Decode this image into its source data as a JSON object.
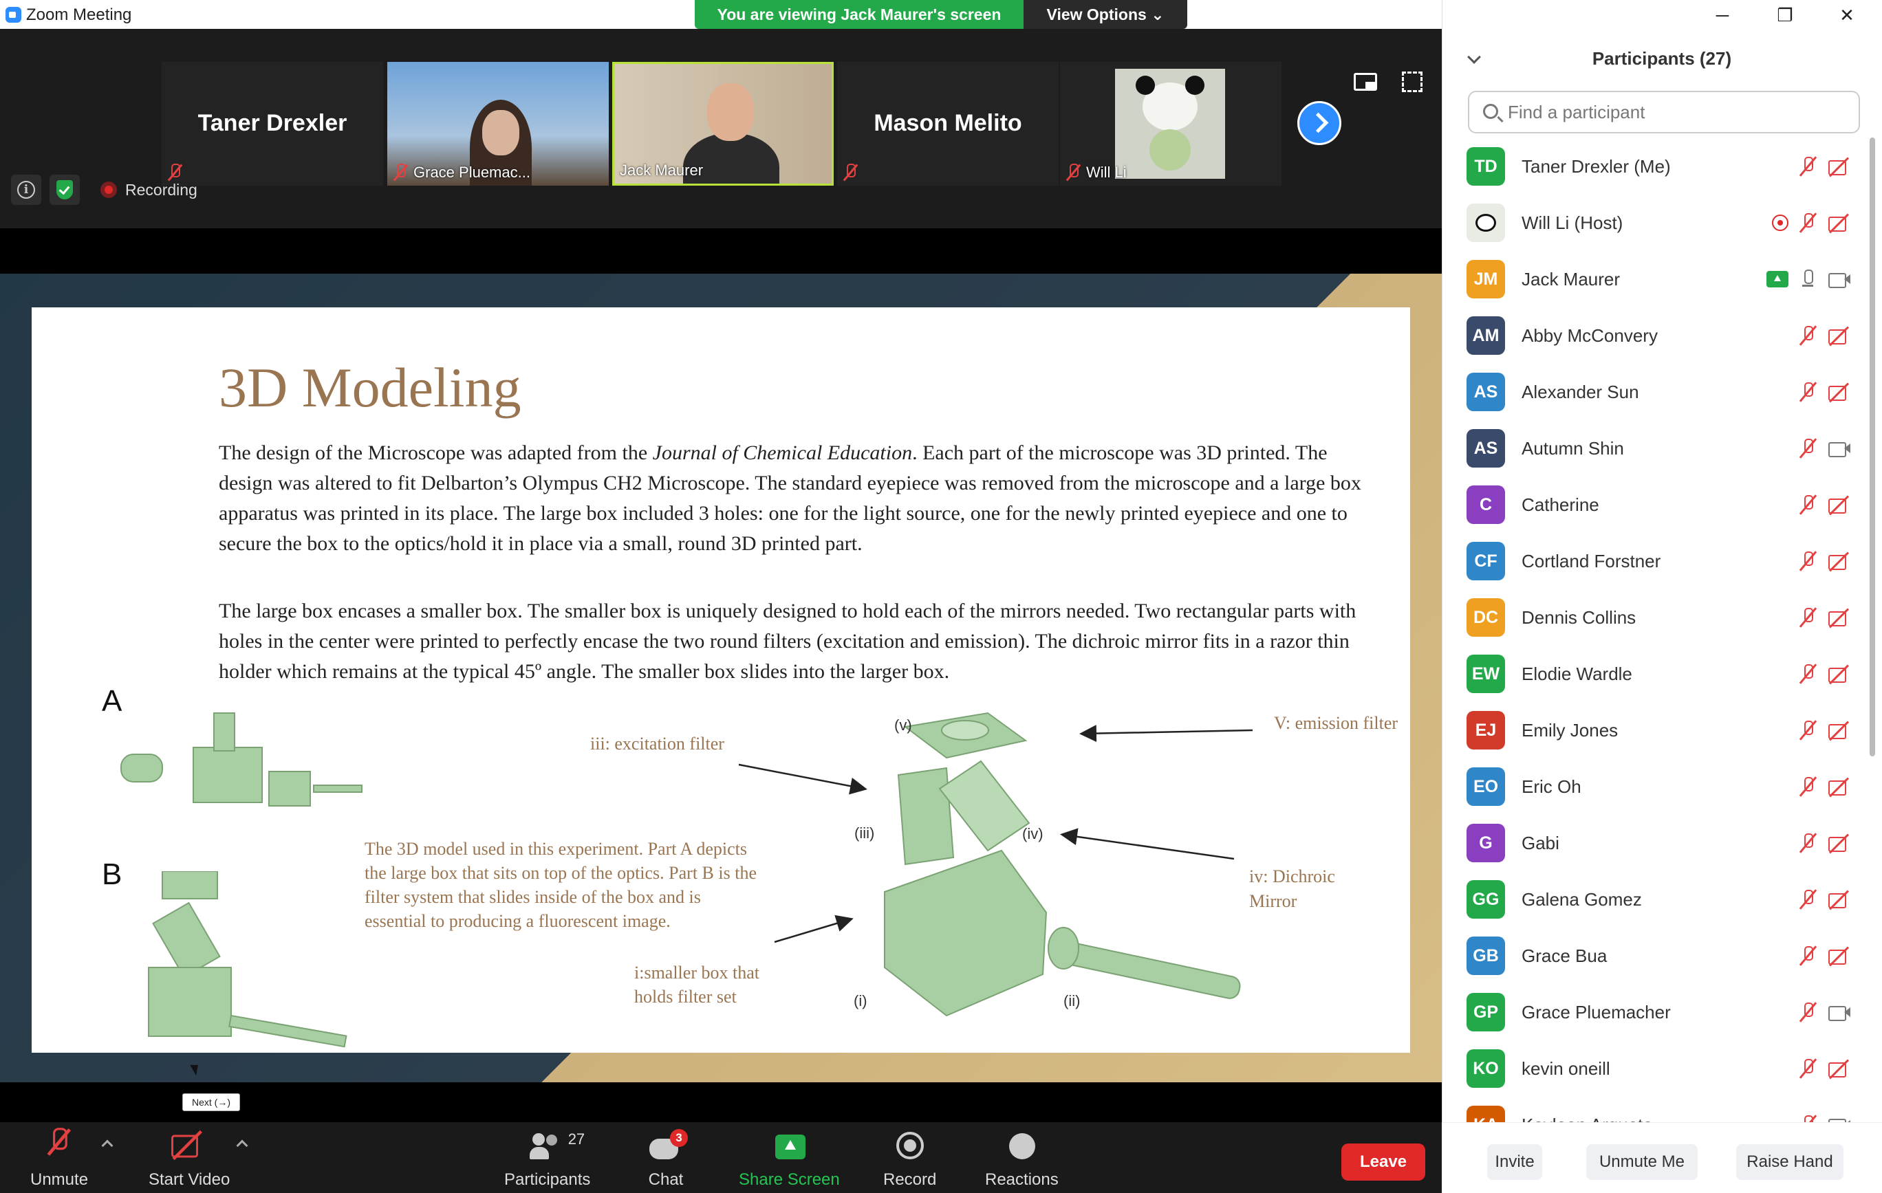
{
  "window": {
    "title": "Zoom Meeting"
  },
  "banner": {
    "viewing": "You are viewing Jack Maurer's screen",
    "view_options": "View Options ⌄"
  },
  "gallery": [
    {
      "name": "Taner Drexler",
      "caption": "",
      "big_name": "Taner Drexler"
    },
    {
      "name": "Grace Pluemac...",
      "caption": "Grace Pluemac..."
    },
    {
      "name": "Jack Maurer",
      "caption": "Jack Maurer"
    },
    {
      "name": "Mason Melito",
      "caption": "",
      "big_name": "Mason Melito"
    },
    {
      "name": "Will Li",
      "caption": "Will Li"
    }
  ],
  "status": {
    "recording": "Recording"
  },
  "slide": {
    "title": "3D Modeling",
    "para1_a": "The design of the Microscope was adapted from the ",
    "para1_journal": "Journal of Chemical Education",
    "para1_b": ". Each part of the microscope was 3D printed.  The design was altered to fit Delbarton’s Olympus CH2 Microscope.  The standard eyepiece was removed from the microscope and a large box apparatus was printed in its place. The large box included 3 holes: one for the light source, one for the newly printed eyepiece and one to secure the box to the optics/hold it in place via a small, round 3D printed part.",
    "para2": "The large box encases a smaller box. The smaller box is uniquely designed to hold each of the mirrors needed. Two  rectangular parts with holes in the center were printed to perfectly encase the two round filters (excitation and emission). The dichroic mirror fits in a razor thin holder which remains at the typical 45º angle. The smaller box slides into the larger box.",
    "label_a": "A",
    "label_b": "B",
    "caption": "The 3D model used in this experiment. Part A depicts the large box that sits on top of the optics. Part B is the filter system that slides inside of the box and is essential to producing a fluorescent image.",
    "iii_label": "iii: excitation filter",
    "v_label": "V: emission filter",
    "iv_label": "iv: Dichroic Mirror",
    "i_label": "i:smaller box that holds filter set",
    "roman": {
      "v": "(v)",
      "iii": "(iii)",
      "iv": "(iv)",
      "i": "(i)",
      "ii": "(ii)"
    }
  },
  "tooltip": "Next (→)",
  "toolbar": {
    "unmute": "Unmute",
    "start_video": "Start Video",
    "participants": "Participants",
    "participants_count": "27",
    "chat": "Chat",
    "chat_badge": "3",
    "share": "Share Screen",
    "record": "Record",
    "reactions": "Reactions",
    "leave": "Leave"
  },
  "panel": {
    "title": "Participants (27)",
    "search_placeholder": "Find a participant",
    "participants": [
      {
        "initials": "TD",
        "name": "Taner Drexler (Me)",
        "color": "#23a94a",
        "mic": "off",
        "video": "off"
      },
      {
        "initials": "",
        "name": "Will Li (Host)",
        "color": "#ccc",
        "mic": "off",
        "video": "off",
        "recording": true,
        "panda": true
      },
      {
        "initials": "JM",
        "name": "Jack Maurer",
        "color": "#f0a020",
        "mic": "on",
        "video": "on",
        "sharing": true
      },
      {
        "initials": "AM",
        "name": "Abby McConvery",
        "color": "#3a4a6a",
        "mic": "off",
        "video": "off"
      },
      {
        "initials": "AS",
        "name": "Alexander Sun",
        "color": "#2f86c8",
        "mic": "off",
        "video": "off"
      },
      {
        "initials": "AS",
        "name": "Autumn Shin",
        "color": "#3a4a6a",
        "mic": "off",
        "video": "on"
      },
      {
        "initials": "C",
        "name": "Catherine",
        "color": "#8a3fc0",
        "mic": "off",
        "video": "off"
      },
      {
        "initials": "CF",
        "name": "Cortland Forstner",
        "color": "#2f86c8",
        "mic": "off",
        "video": "off"
      },
      {
        "initials": "DC",
        "name": "Dennis Collins",
        "color": "#f0a020",
        "mic": "off",
        "video": "off"
      },
      {
        "initials": "EW",
        "name": "Elodie Wardle",
        "color": "#23a94a",
        "mic": "off",
        "video": "off"
      },
      {
        "initials": "EJ",
        "name": "Emily Jones",
        "color": "#d23a2a",
        "mic": "off",
        "video": "off"
      },
      {
        "initials": "EO",
        "name": "Eric Oh",
        "color": "#2f86c8",
        "mic": "off",
        "video": "off"
      },
      {
        "initials": "G",
        "name": "Gabi",
        "color": "#8a3fc0",
        "mic": "off",
        "video": "off"
      },
      {
        "initials": "GG",
        "name": "Galena Gomez",
        "color": "#23a94a",
        "mic": "off",
        "video": "off"
      },
      {
        "initials": "GB",
        "name": "Grace Bua",
        "color": "#2f86c8",
        "mic": "off",
        "video": "off"
      },
      {
        "initials": "GP",
        "name": "Grace Pluemacher",
        "color": "#23a94a",
        "mic": "off",
        "video": "on"
      },
      {
        "initials": "KO",
        "name": "kevin oneill",
        "color": "#23a94a",
        "mic": "off",
        "video": "off"
      },
      {
        "initials": "KA",
        "name": "Kayleen Argueta",
        "color": "#d45a00",
        "mic": "off",
        "video": "on"
      }
    ],
    "buttons": {
      "invite": "Invite",
      "unmute_me": "Unmute Me",
      "raise_hand": "Raise Hand"
    }
  }
}
